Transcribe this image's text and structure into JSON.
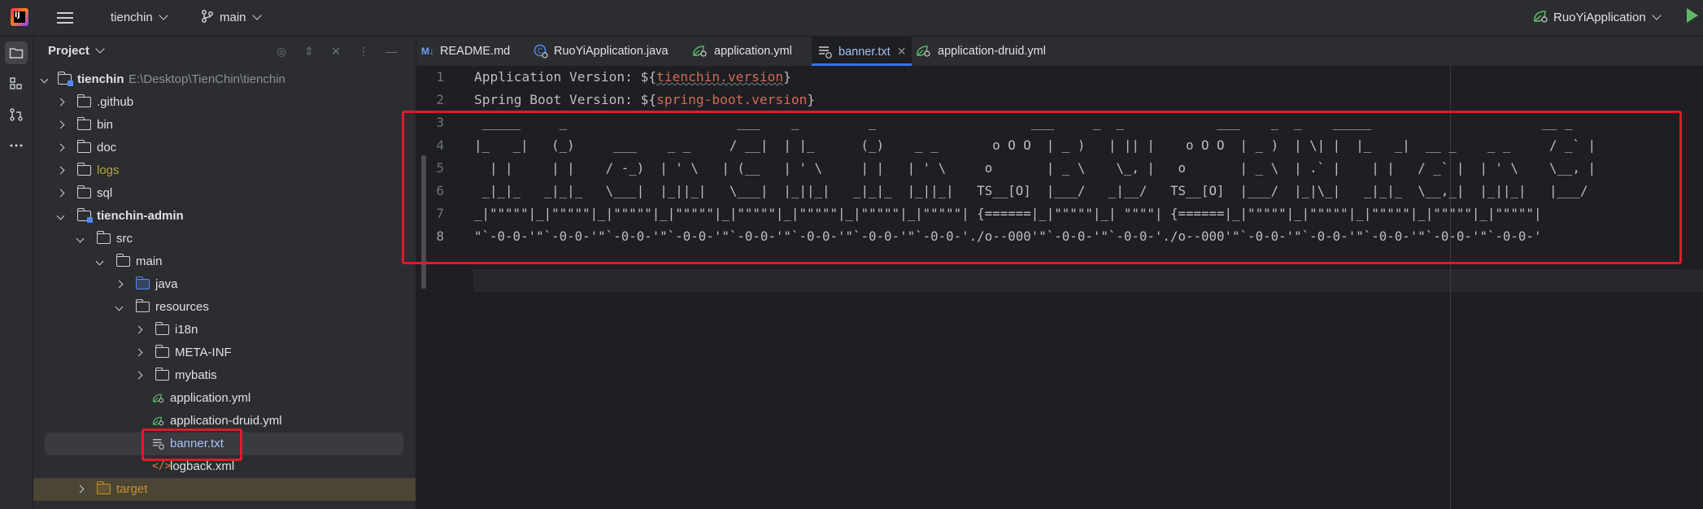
{
  "titlebar": {
    "project_name": "tienchin",
    "branch": "main",
    "run_config": "RuoYiApplication"
  },
  "project_panel": {
    "title": "Project",
    "tree": [
      {
        "label": "tienchin",
        "path": "E:\\Desktop\\TienChin\\tienchin"
      },
      {
        "label": ".github"
      },
      {
        "label": "bin"
      },
      {
        "label": "doc"
      },
      {
        "label": "logs"
      },
      {
        "label": "sql"
      },
      {
        "label": "tienchin-admin"
      },
      {
        "label": "src"
      },
      {
        "label": "main"
      },
      {
        "label": "java"
      },
      {
        "label": "resources"
      },
      {
        "label": "i18n"
      },
      {
        "label": "META-INF"
      },
      {
        "label": "mybatis"
      },
      {
        "label": "application.yml"
      },
      {
        "label": "application-druid.yml"
      },
      {
        "label": "banner.txt"
      },
      {
        "label": "logback.xml"
      },
      {
        "label": "target"
      }
    ]
  },
  "tabs": [
    {
      "label": "README.md",
      "icon": "markdown-icon"
    },
    {
      "label": "RuoYiApplication.java",
      "icon": "java-class-icon"
    },
    {
      "label": "application.yml",
      "icon": "spring-yml-icon"
    },
    {
      "label": "banner.txt",
      "icon": "text-file-icon",
      "active": true
    },
    {
      "label": "application-druid.yml",
      "icon": "spring-yml-icon"
    }
  ],
  "editor": {
    "line_numbers": [
      "1",
      "2",
      "3",
      "4",
      "5",
      "6",
      "7",
      "8"
    ],
    "line1": {
      "prefix": "Application Version: ${",
      "var": "tienchin.version",
      "suffix": "}"
    },
    "line2": {
      "prefix": "Spring Boot Version: ${",
      "var": "spring-boot.version",
      "suffix": "}"
    },
    "ascii": [
      " _____     _                      ___    _         _                    ___     _  _            ___    _  _    _____                      __ _",
      "|_   _|   (_)     ___    _ _     / __|  | |_      (_)    _ _       o O O  | _ )   | || |    o O O  | _ )  | \\| |  |_   _|  __ _    _ _     / _` |",
      "  | |     | |    / -_)  | ' \\   | (__   | ' \\     | |   | ' \\     o       | _ \\    \\_, |   o       | _ \\  | .` |    | |   / _` |  | ' \\    \\__, |",
      " _|_|_   _|_|_   \\___|  |_||_|   \\___|  |_||_|   _|_|_  |_||_|   TS__[O]  |___/   _|__/   TS__[O]  |___/  |_|\\_|   _|_|_  \\__,_|  |_||_|   |___/",
      "_|\"\"\"\"\"|_|\"\"\"\"\"|_|\"\"\"\"\"|_|\"\"\"\"\"|_|\"\"\"\"\"|_|\"\"\"\"\"|_|\"\"\"\"\"|_|\"\"\"\"\"| {======|_|\"\"\"\"\"|_| \"\"\"\"| {======|_|\"\"\"\"\"|_|\"\"\"\"\"|_|\"\"\"\"\"|_|\"\"\"\"\"|_|\"\"\"\"\"|",
      "\"`-0-0-'\"`-0-0-'\"`-0-0-'\"`-0-0-'\"`-0-0-'\"`-0-0-'\"`-0-0-'\"`-0-0-'./o--000'\"`-0-0-'\"`-0-0-'./o--000'\"`-0-0-'\"`-0-0-'\"`-0-0-'\"`-0-0-'\"`-0-0-'"
    ]
  },
  "colors": {
    "background": "#1e1f22",
    "panel": "#2b2d30",
    "accent": "#3574f0",
    "variable": "#cf6c5b",
    "highlight_box": "#e0192a"
  }
}
